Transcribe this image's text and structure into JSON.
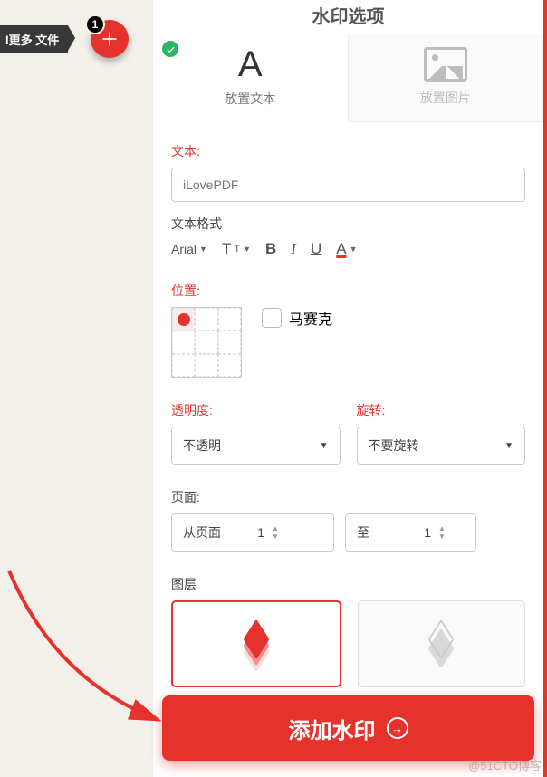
{
  "left": {
    "file_tag": "l更多 文件",
    "fab_badge": "1"
  },
  "panel_title": "水印选项",
  "tabs": {
    "text": "放置文本",
    "image": "放置图片"
  },
  "text_section": {
    "label": "文本:",
    "value": "iLovePDF",
    "format_label": "文本格式",
    "font": "Arial"
  },
  "position": {
    "label": "位置:",
    "mosaic": "马赛克"
  },
  "opacity": {
    "label": "透明度:",
    "value": "不透明"
  },
  "rotate": {
    "label": "旋转:",
    "value": "不要旋转"
  },
  "pages": {
    "label": "页面:",
    "from_label": "从页面",
    "from_value": "1",
    "to_label": "至",
    "to_value": "1"
  },
  "layers": {
    "label": "图层"
  },
  "cta": "添加水印",
  "watermark": "@51CTO博客"
}
